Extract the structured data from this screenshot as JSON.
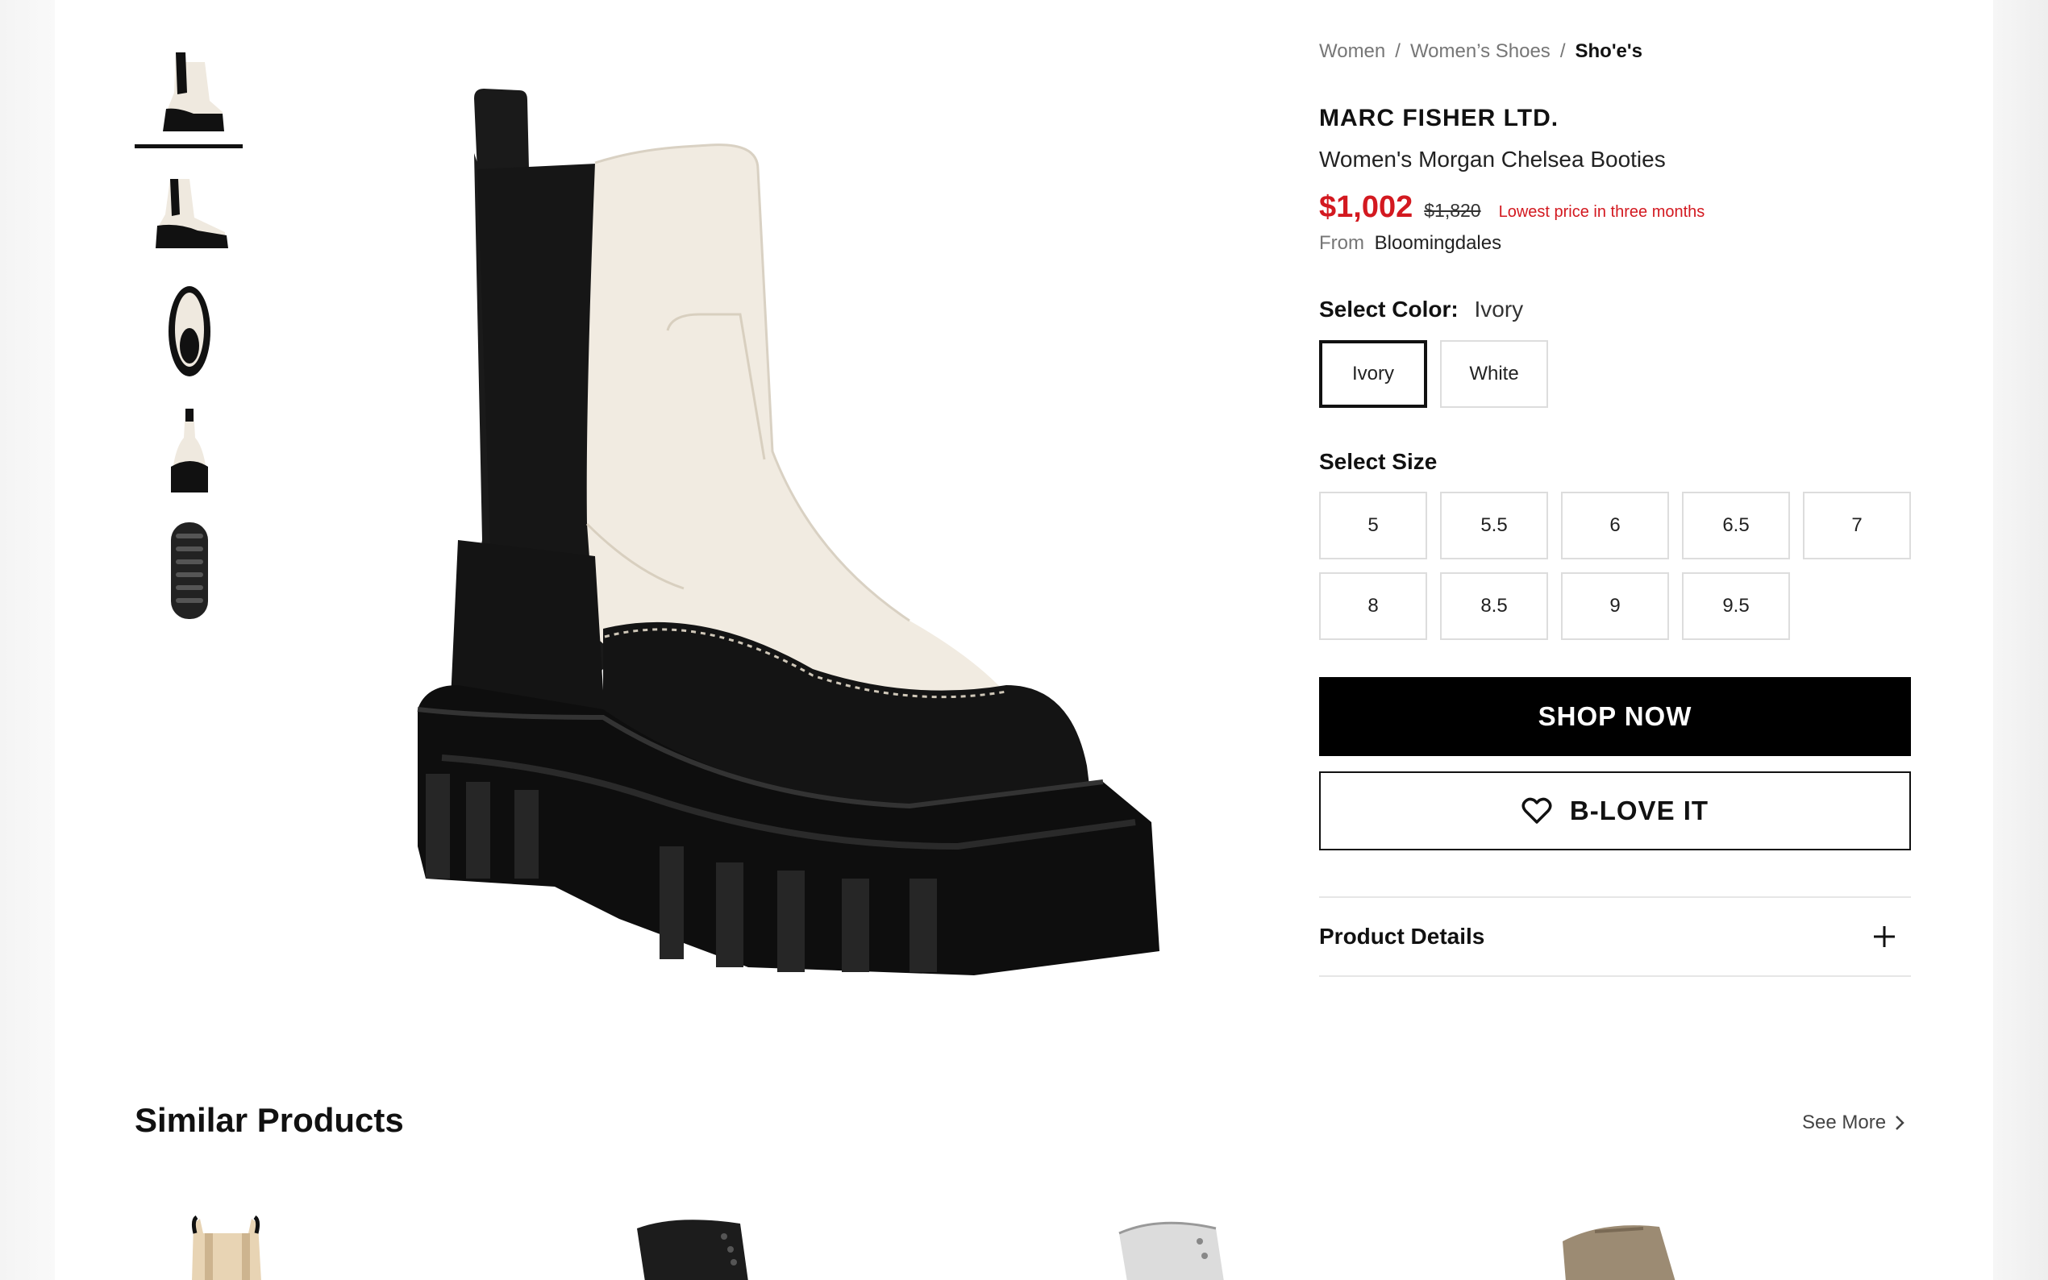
{
  "breadcrumb": {
    "items": [
      "Women",
      "Women’s Shoes"
    ],
    "current": "Sho'e's"
  },
  "product": {
    "brand": "MARC FISHER LTD.",
    "name": "Women's Morgan Chelsea Booties",
    "price": "$1,002",
    "original_price": "$1,820",
    "price_note": "Lowest price in three months",
    "from_label": "From",
    "store": "Bloomingdales"
  },
  "color": {
    "label": "Select Color:",
    "selected": "Ivory",
    "options": [
      "Ivory",
      "White"
    ]
  },
  "size": {
    "label": "Select Size",
    "options": [
      "5",
      "5.5",
      "6",
      "6.5",
      "7",
      "8",
      "8.5",
      "9",
      "9.5"
    ]
  },
  "actions": {
    "shop_now": "SHOP NOW",
    "love_it": "B-LOVE IT"
  },
  "details": {
    "label": "Product Details"
  },
  "similar": {
    "title": "Similar Products",
    "see_more": "See More"
  },
  "icons": {
    "close": "close-icon",
    "heart": "heart-icon",
    "plus": "plus-icon",
    "chevron": "chevron-right-icon"
  },
  "colors": {
    "price_red": "#d31920",
    "primary_button": "#000000"
  }
}
